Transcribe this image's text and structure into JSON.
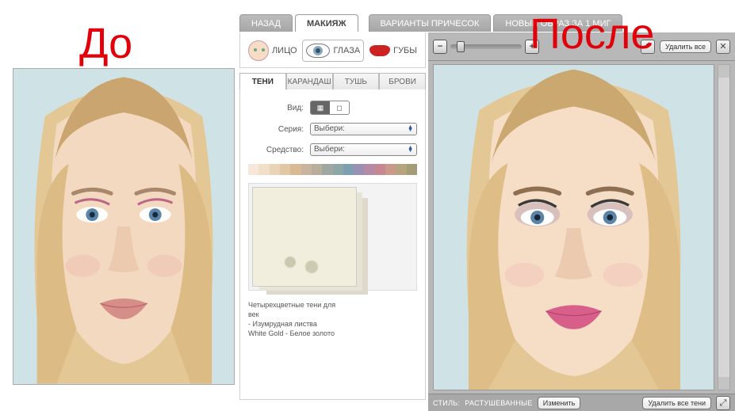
{
  "labels": {
    "before": "До",
    "after": "После"
  },
  "top_tabs": {
    "back": "НАЗАД",
    "makeup": "МАКИЯЖ",
    "hair": "ВАРИАНТЫ ПРИЧЕСОК",
    "look": "НОВЫЙ ОБРАЗ ЗА 1 МИГ"
  },
  "subtool": {
    "face": "ЛИЦО",
    "eyes": "ГЛАЗА",
    "lips": "ГУБЫ"
  },
  "sec_tabs": {
    "shadows": "ТЕНИ",
    "pencil": "КАРАНДАШ",
    "mascara": "ТУШЬ",
    "brows": "БРОВИ"
  },
  "fields": {
    "view_label": "Вид:",
    "series_label": "Серия:",
    "series_value": "Выбери:",
    "product_label": "Средство:",
    "product_value": "Выбери:"
  },
  "palette": [
    "#f6e7d8",
    "#f1dfc7",
    "#ead4b7",
    "#e1c7a4",
    "#d9ba92",
    "#c9b49e",
    "#b8ae9c",
    "#a0a7a0",
    "#8da6a6",
    "#7e9fb2",
    "#9a8fb5",
    "#b58aa6",
    "#c78790",
    "#c99a8b",
    "#b6a47e",
    "#a39c74"
  ],
  "product_text": {
    "l1": "Четырехцветные тени для",
    "l2": "век",
    "l3": "- Изумрудная листва",
    "l4": "White Gold - Белое золото"
  },
  "right_toolbar": {
    "delete_all": "Удалить все"
  },
  "status": {
    "style_label": "СТИЛЬ:",
    "style_value": "РАСТУШЕВАННЫЕ",
    "change": "Изменить",
    "delete_all_shadows": "Удалить все тени"
  },
  "icons": {
    "minus": "−",
    "plus": "+",
    "undo": "↶",
    "close": "✕",
    "expand": "⤢",
    "up": "▲",
    "down": "▼",
    "grid": "▦",
    "single": "◻"
  }
}
